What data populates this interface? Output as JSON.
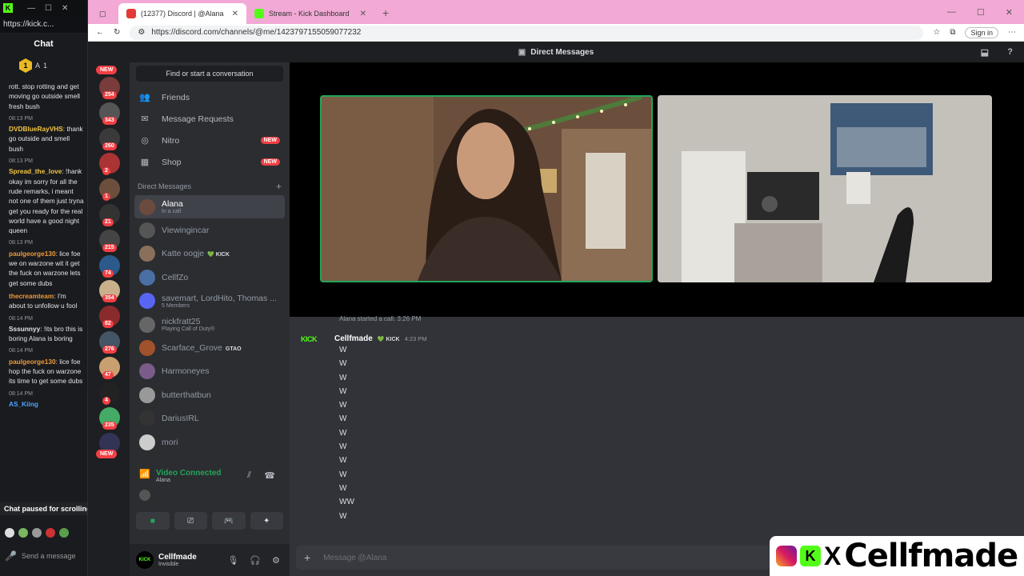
{
  "kick_popout": {
    "window_url": "https://kick.c...",
    "chat_title": "Chat",
    "leader_badge": "1",
    "leader_name": "A",
    "leader_sub": "6(",
    "leader_count_1": "1",
    "leader_count_2": "1",
    "messages": [
      {
        "time": "",
        "user": "",
        "text": "rott. stop rotting and get moving go outside smell fresh bush",
        "color": "#e4e4e4"
      },
      {
        "time": "08:13 PM",
        "user": "DVDBlueRayVHS",
        "text": "thank go outside and smell bush",
        "color": "#f5c542"
      },
      {
        "time": "08:13 PM",
        "user": "Spread_the_love",
        "text": "!hank okay im sorry for all the rude remarks, i meant not one of them just tryna get you ready for the real world have a good night queen",
        "color": "#f5c542"
      },
      {
        "time": "08:13 PM",
        "user": "paulgeorge130",
        "text": "lice foe we on warzone wit it get the fuck on warzone lets get some dubs",
        "color": "#f09a36"
      },
      {
        "time": "",
        "user": "thecreamteam",
        "text": "I'm about to unfollow u fool",
        "color": "#f09a36"
      },
      {
        "time": "08:14 PM",
        "user": "Sssunnyy",
        "text": "!its bro this is boring Alana is boring",
        "color": "#e4e4e4"
      },
      {
        "time": "08:14 PM",
        "user": "paulgeorge130",
        "text": "lice foe hop the fuck on warzone its time to get some dubs",
        "color": "#f09a36"
      },
      {
        "time": "08:14 PM",
        "user": "AS_Kiing",
        "text": "",
        "color": "#4fa3ff"
      }
    ],
    "paused_text": "Chat paused for scrolling",
    "send_placeholder": "Send a message"
  },
  "browser": {
    "tabs": [
      {
        "label": "(12377) Discord | @Alana",
        "favicon_color": "#e53935"
      },
      {
        "label": "Stream - Kick Dashboard",
        "favicon_color": "#53fc18"
      }
    ],
    "url": "https://discord.com/channels/@me/1423797155059077232",
    "signin_label": "Sign in"
  },
  "discord": {
    "header_title": "Direct Messages",
    "find_placeholder": "Find or start a conversation",
    "nav": [
      {
        "label": "Friends",
        "icon": "friends-icon",
        "glyph": "👥",
        "new": ""
      },
      {
        "label": "Message Requests",
        "icon": "mail-icon",
        "glyph": "✉",
        "new": ""
      },
      {
        "label": "Nitro",
        "icon": "nitro-icon",
        "glyph": "◎",
        "new": "NEW"
      },
      {
        "label": "Shop",
        "icon": "shop-icon",
        "glyph": "▦",
        "new": "NEW"
      }
    ],
    "dm_header": "Direct Messages",
    "dms": [
      {
        "name": "Alana",
        "sub": "In a call",
        "tag": "",
        "color": "#6b4b3e",
        "active": true
      },
      {
        "name": "Viewingincar",
        "sub": "",
        "tag": "",
        "color": "#555",
        "active": false
      },
      {
        "name": "Katte oogje",
        "sub": "",
        "tag": "💚 KICK",
        "color": "#8a6f5a",
        "active": false
      },
      {
        "name": "CellfZo",
        "sub": "",
        "tag": "",
        "color": "#4a6fa5",
        "active": false
      },
      {
        "name": "savemart, LordHito, Thomas ...",
        "sub": "5 Members",
        "tag": "",
        "color": "#5865f2",
        "active": false
      },
      {
        "name": "nickfratt25",
        "sub": "Playing Call of Duty®",
        "tag": "",
        "color": "#666",
        "active": false
      },
      {
        "name": "Scarface_Grove",
        "sub": "",
        "tag": "GTAO",
        "color": "#a0522d",
        "active": false
      },
      {
        "name": "Harmoneyes",
        "sub": "",
        "tag": "",
        "color": "#7a5c8a",
        "active": false
      },
      {
        "name": "butterthatbun",
        "sub": "",
        "tag": "",
        "color": "#999",
        "active": false
      },
      {
        "name": "DariusIRL",
        "sub": "",
        "tag": "",
        "color": "#333",
        "active": false
      },
      {
        "name": "mori",
        "sub": "",
        "tag": "",
        "color": "#ccc",
        "active": false
      }
    ],
    "server_badges": [
      "254",
      "343",
      "260",
      "2",
      "1",
      "21",
      "215",
      "74",
      "354",
      "82",
      "276",
      "47",
      "4",
      "235"
    ],
    "voice": {
      "status": "Video Connected",
      "channel": "Alana"
    },
    "user": {
      "name": "Cellfmade",
      "status": "Invisible",
      "avatar_text": "KICK"
    },
    "chat": {
      "call_note": "Alana started a call. 3:26 PM",
      "author": "Cellfmade",
      "author_tag": "💚 KICK",
      "time": "4:23 PM",
      "avatar_text": "KICK",
      "lines": [
        "W",
        "W",
        "W",
        "W",
        "W",
        "W",
        "W",
        "W",
        "W",
        "W",
        "W",
        "WW",
        "W"
      ],
      "composer_placeholder": "Message @Alana"
    }
  },
  "overlay": {
    "handle": "Cellfmade",
    "x_label": "X",
    "kick_letter": "K"
  }
}
